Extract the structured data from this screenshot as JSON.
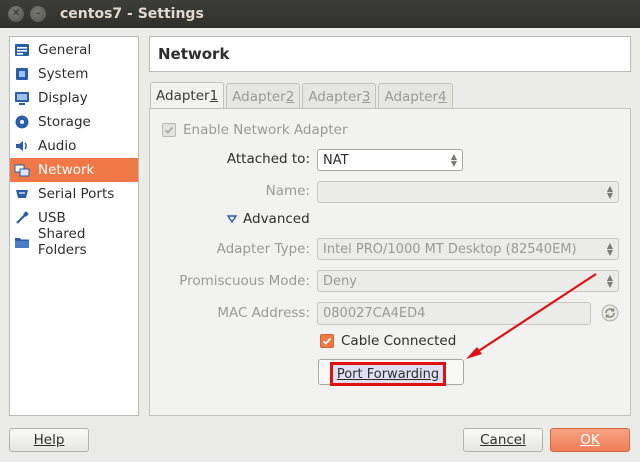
{
  "window": {
    "title": "centos7 - Settings",
    "close_glyph": "✕",
    "min_glyph": "–"
  },
  "sidebar": {
    "items": [
      {
        "label": "General",
        "icon": "general-icon"
      },
      {
        "label": "System",
        "icon": "system-icon"
      },
      {
        "label": "Display",
        "icon": "display-icon"
      },
      {
        "label": "Storage",
        "icon": "storage-icon"
      },
      {
        "label": "Audio",
        "icon": "audio-icon"
      },
      {
        "label": "Network",
        "icon": "network-icon",
        "active": true
      },
      {
        "label": "Serial Ports",
        "icon": "serial-ports-icon"
      },
      {
        "label": "USB",
        "icon": "usb-icon"
      },
      {
        "label": "Shared Folders",
        "icon": "shared-folders-icon"
      }
    ]
  },
  "section_title": "Network",
  "tabs": [
    {
      "label": "Adapter ",
      "num": "1",
      "active": true
    },
    {
      "label": "Adapter ",
      "num": "2"
    },
    {
      "label": "Adapter ",
      "num": "3"
    },
    {
      "label": "Adapter ",
      "num": "4"
    }
  ],
  "adapter": {
    "enable_label": "Enable Network Adapter",
    "enable_checked": true,
    "attached_label": "Attached to:",
    "attached_value": "NAT",
    "name_label": "Name:",
    "name_value": "",
    "advanced_label": "Advanced",
    "adapter_type_label": "Adapter Type:",
    "adapter_type_value": "Intel PRO/1000 MT Desktop (82540EM)",
    "promiscuous_label": "Promiscuous Mode:",
    "promiscuous_value": "Deny",
    "mac_label": "MAC Address:",
    "mac_value": "080027CA4ED4",
    "cable_label": "Cable Connected",
    "cable_checked": true,
    "port_forwarding_label": "Port Forwarding"
  },
  "buttons": {
    "help": "Help",
    "cancel": "Cancel",
    "ok": "OK"
  },
  "colors": {
    "accent": "#f07746",
    "highlight": "#e01010"
  }
}
